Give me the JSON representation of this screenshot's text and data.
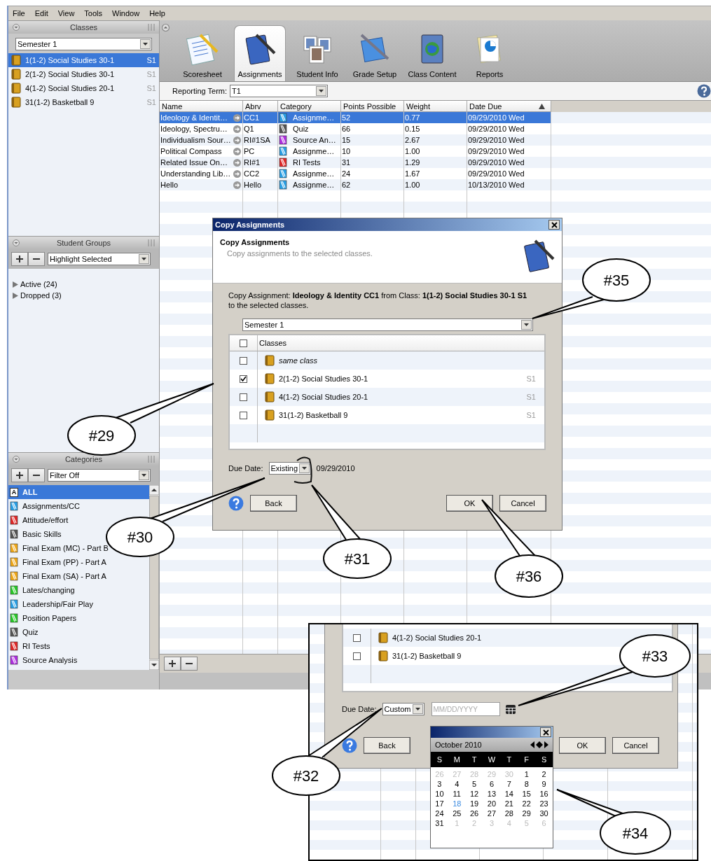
{
  "menu": [
    "File",
    "Edit",
    "View",
    "Tools",
    "Window",
    "Help"
  ],
  "classes_panel": {
    "title": "Classes",
    "term": "Semester 1",
    "classes": [
      {
        "name": "1(1-2) Social Studies 30-1",
        "term": "S1",
        "selected": true
      },
      {
        "name": "2(1-2) Social Studies 30-1",
        "term": "S1",
        "selected": false
      },
      {
        "name": "4(1-2) Social Studies 20-1",
        "term": "S1",
        "selected": false
      },
      {
        "name": "31(1-2) Basketball 9",
        "term": "S1",
        "selected": false
      }
    ]
  },
  "student_groups": {
    "title": "Student Groups",
    "filter": "Highlight Selected",
    "groups": [
      "Active (24)",
      "Dropped (3)"
    ]
  },
  "categories": {
    "title": "Categories",
    "filter": "Filter Off",
    "items": [
      {
        "kind": "all",
        "badge": "A",
        "label": "ALL",
        "selected": true
      },
      {
        "kind": "category",
        "label": "Assignments/CC",
        "color": "#2aa0e6",
        "selected": false
      },
      {
        "kind": "category",
        "label": "Attitude/effort",
        "color": "#e02828",
        "selected": false
      },
      {
        "kind": "category",
        "label": "Basic Skills",
        "color": "#555555",
        "selected": false
      },
      {
        "kind": "category",
        "label": "Final Exam (MC) - Part B",
        "color": "#f0a818",
        "selected": false
      },
      {
        "kind": "category",
        "label": "Final Exam (PP) - Part A",
        "color": "#f0a818",
        "selected": false
      },
      {
        "kind": "category",
        "label": "Final Exam (SA) - Part A",
        "color": "#f0a818",
        "selected": false
      },
      {
        "kind": "category",
        "label": "Lates/changing",
        "color": "#28c828",
        "selected": false
      },
      {
        "kind": "category",
        "label": "Leadership/Fair Play",
        "color": "#2aa0e6",
        "selected": false
      },
      {
        "kind": "category",
        "label": "Position Papers",
        "color": "#28c828",
        "selected": false
      },
      {
        "kind": "category",
        "label": "Quiz",
        "color": "#555555",
        "selected": false
      },
      {
        "kind": "category",
        "label": "RI Tests",
        "color": "#e02828",
        "selected": false
      },
      {
        "kind": "category",
        "label": "Source Analysis",
        "color": "#b030e0",
        "selected": false
      }
    ]
  },
  "tabs": [
    {
      "label": "Scoresheet",
      "selected": false
    },
    {
      "label": "Assignments",
      "selected": true
    },
    {
      "label": "Student Info",
      "selected": false
    },
    {
      "label": "Grade Setup",
      "selected": false
    },
    {
      "label": "Class Content",
      "selected": false
    },
    {
      "label": "Reports",
      "selected": false
    }
  ],
  "reporting_term": {
    "label": "Reporting Term:",
    "value": "T1"
  },
  "assignments_table": {
    "columns": [
      {
        "label": "Name",
        "sorted": false
      },
      {
        "label": "Abrv",
        "sorted": false
      },
      {
        "label": "Category",
        "sorted": false
      },
      {
        "label": "Points Possible",
        "sorted": false
      },
      {
        "label": "Weight",
        "sorted": false
      },
      {
        "label": "Date Due",
        "sorted": true
      }
    ],
    "rows": [
      {
        "name": "Ideology & Identit…",
        "abrv": "CC1",
        "category": "Assignme…",
        "color": "#2aa0e6",
        "points": "52",
        "weight": "0.77",
        "due": "09/29/2010 Wed",
        "selected": true
      },
      {
        "name": "Ideology, Spectru…",
        "abrv": "Q1",
        "category": "Quiz",
        "color": "#555555",
        "points": "66",
        "weight": "0.15",
        "due": "09/29/2010 Wed",
        "selected": false
      },
      {
        "name": "Individualism Sour…",
        "abrv": "RI#1SA",
        "category": "Source An…",
        "color": "#b030e0",
        "points": "15",
        "weight": "2.67",
        "due": "09/29/2010 Wed",
        "selected": false
      },
      {
        "name": "Political Compass",
        "abrv": "PC",
        "category": "Assignme…",
        "color": "#2aa0e6",
        "points": "10",
        "weight": "1.00",
        "due": "09/29/2010 Wed",
        "selected": false
      },
      {
        "name": "Related Issue On…",
        "abrv": "RI#1",
        "category": "RI Tests",
        "color": "#e02828",
        "points": "31",
        "weight": "1.29",
        "due": "09/29/2010 Wed",
        "selected": false
      },
      {
        "name": "Understanding Lib…",
        "abrv": "CC2",
        "category": "Assignme…",
        "color": "#2aa0e6",
        "points": "24",
        "weight": "1.67",
        "due": "09/29/2010 Wed",
        "selected": false
      },
      {
        "name": "Hello",
        "abrv": "Hello",
        "category": "Assignme…",
        "color": "#2aa0e6",
        "points": "62",
        "weight": "1.00",
        "due": "10/13/2010 Wed",
        "selected": false
      }
    ]
  },
  "dialog": {
    "title": "Copy Assignments",
    "heading": "Copy Assignments",
    "subheading": "Copy assignments to the selected classes.",
    "message": "Copy Assignment: **Ideology & Identity CC1** from Class: **1(1-2) Social Studies 30-1 S1** to the selected classes.",
    "term": "Semester 1",
    "list_header": "Classes",
    "header_checked": false,
    "classes": [
      {
        "kind": "same",
        "name": "same class",
        "checked": false
      },
      {
        "kind": "class",
        "name": "2(1-2) Social Studies 30-1",
        "term": "S1",
        "checked": true
      },
      {
        "kind": "class",
        "name": "4(1-2) Social Studies 20-1",
        "term": "S1",
        "checked": false
      },
      {
        "kind": "class",
        "name": "31(1-2) Basketball 9",
        "term": "S1",
        "checked": false
      }
    ],
    "due_label": "Due Date:",
    "due_mode": "Existing",
    "due_date": "09/29/2010",
    "back": "Back",
    "ok": "OK",
    "cancel": "Cancel"
  },
  "inset": {
    "classes": [
      {
        "name": "4(1-2) Social Studies 20-1",
        "checked": false
      },
      {
        "name": "31(1-2) Basketball 9",
        "checked": false
      }
    ],
    "due_label": "Due Date:",
    "due_mode": "Custom",
    "date_placeholder": "MM/DD/YYYY",
    "back": "Back",
    "ok": "OK",
    "cancel": "Cancel",
    "calendar": {
      "month": "October 2010",
      "weekdays": [
        "S",
        "M",
        "T",
        "W",
        "T",
        "F",
        "S"
      ],
      "days": [
        {
          "label": "26",
          "outside": true,
          "today": false
        },
        {
          "label": "27",
          "outside": true,
          "today": false
        },
        {
          "label": "28",
          "outside": true,
          "today": false
        },
        {
          "label": "29",
          "outside": true,
          "today": false
        },
        {
          "label": "30",
          "outside": true,
          "today": false
        },
        {
          "label": "1",
          "outside": false,
          "today": false
        },
        {
          "label": "2",
          "outside": false,
          "today": false
        },
        {
          "label": "3",
          "outside": false,
          "today": false
        },
        {
          "label": "4",
          "outside": false,
          "today": false
        },
        {
          "label": "5",
          "outside": false,
          "today": false
        },
        {
          "label": "6",
          "outside": false,
          "today": false
        },
        {
          "label": "7",
          "outside": false,
          "today": false
        },
        {
          "label": "8",
          "outside": false,
          "today": false
        },
        {
          "label": "9",
          "outside": false,
          "today": false
        },
        {
          "label": "10",
          "outside": false,
          "today": false
        },
        {
          "label": "11",
          "outside": false,
          "today": false
        },
        {
          "label": "12",
          "outside": false,
          "today": false
        },
        {
          "label": "13",
          "outside": false,
          "today": false
        },
        {
          "label": "14",
          "outside": false,
          "today": false
        },
        {
          "label": "15",
          "outside": false,
          "today": false
        },
        {
          "label": "16",
          "outside": false,
          "today": false
        },
        {
          "label": "17",
          "outside": false,
          "today": false
        },
        {
          "label": "18",
          "outside": false,
          "today": true
        },
        {
          "label": "19",
          "outside": false,
          "today": false
        },
        {
          "label": "20",
          "outside": false,
          "today": false
        },
        {
          "label": "21",
          "outside": false,
          "today": false
        },
        {
          "label": "22",
          "outside": false,
          "today": false
        },
        {
          "label": "23",
          "outside": false,
          "today": false
        },
        {
          "label": "24",
          "outside": false,
          "today": false
        },
        {
          "label": "25",
          "outside": false,
          "today": false
        },
        {
          "label": "26",
          "outside": false,
          "today": false
        },
        {
          "label": "27",
          "outside": false,
          "today": false
        },
        {
          "label": "28",
          "outside": false,
          "today": false
        },
        {
          "label": "29",
          "outside": false,
          "today": false
        },
        {
          "label": "30",
          "outside": false,
          "today": false
        },
        {
          "label": "31",
          "outside": false,
          "today": false
        },
        {
          "label": "1",
          "outside": true,
          "today": false
        },
        {
          "label": "2",
          "outside": true,
          "today": false
        },
        {
          "label": "3",
          "outside": true,
          "today": false
        },
        {
          "label": "4",
          "outside": true,
          "today": false
        },
        {
          "label": "5",
          "outside": true,
          "today": false
        },
        {
          "label": "6",
          "outside": true,
          "today": false
        }
      ]
    }
  },
  "callouts": [
    "#35",
    "#29",
    "#30",
    "#31",
    "#36",
    "#33",
    "#32",
    "#34"
  ]
}
